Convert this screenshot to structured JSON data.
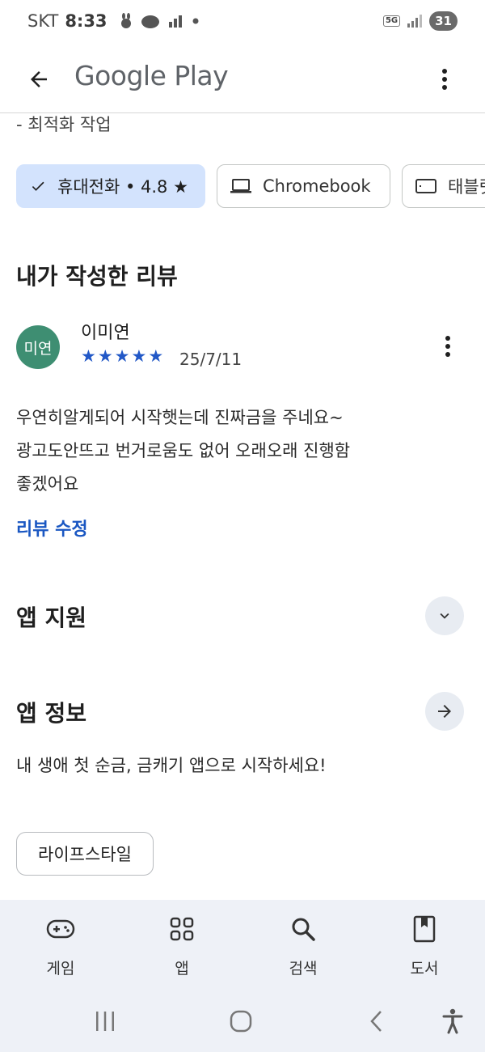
{
  "status_bar": {
    "carrier": "SKT",
    "time": "8:33",
    "network": "5G",
    "battery": "31"
  },
  "app_bar": {
    "title": "Google Play"
  },
  "clipped_text": "- 최적화 작업",
  "device_chips": [
    {
      "label": "휴대전화 • 4.8 ★",
      "selected": true
    },
    {
      "label": "Chromebook",
      "selected": false
    },
    {
      "label": "태블릿",
      "selected": false
    }
  ],
  "my_review": {
    "section_title": "내가 작성한 리뷰",
    "avatar_text": "미연",
    "avatar_color": "#3e8e72",
    "reviewer": "이미연",
    "rating": 5,
    "date": "25/7/11",
    "text_lines": [
      "우연히알게되어 시작햇는데 진짜금을 주네요~",
      "광고도안뜨고 번거로움도 없어 오래오래 진행함",
      "좋겠어요"
    ],
    "edit_label": "리뷰 수정"
  },
  "app_support": {
    "title": "앱 지원"
  },
  "app_info": {
    "title": "앱 정보",
    "description": "내 생애 첫 순금, 금캐기 앱으로 시작하세요!",
    "category": "라이프스타일"
  },
  "bottom_nav": [
    {
      "label": "게임",
      "icon": "gamepad-icon"
    },
    {
      "label": "앱",
      "icon": "apps-grid-icon"
    },
    {
      "label": "검색",
      "icon": "search-icon"
    },
    {
      "label": "도서",
      "icon": "book-icon"
    }
  ],
  "colors": {
    "accent_blue": "#1a57c2",
    "star_blue": "#2258c7",
    "selected_chip": "#d3e3fd",
    "nav_background": "#eef1f7"
  }
}
